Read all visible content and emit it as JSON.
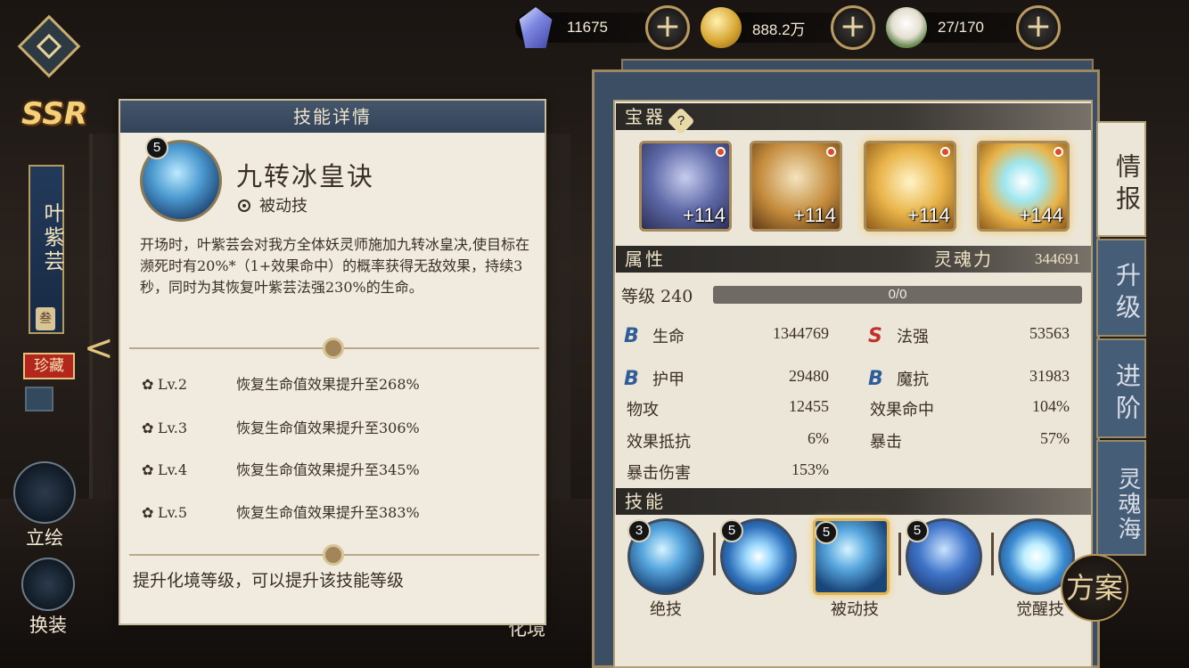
{
  "resources": [
    {
      "icon": "crystal-icon",
      "value": "11675"
    },
    {
      "icon": "gold-coin-icon",
      "value": "888.2万"
    },
    {
      "icon": "steamed-bun-icon",
      "value": "27/170"
    }
  ],
  "character": {
    "rarity": "SSR",
    "name": "叶紫芸",
    "rank_chip": "叁",
    "collect_tag": "珍藏",
    "buttons": {
      "portrait": "立绘",
      "outfit": "换装",
      "realm": "化境"
    }
  },
  "skill_detail": {
    "header": "技能详情",
    "level": "5",
    "name": "九转冰皇诀",
    "type": "被动技",
    "description": "开场时，叶紫芸会对我方全体妖灵师施加九转冰皇决,使目标在濒死时有20%*（1+效果命中）的概率获得无敌效果，持续3秒，同时为其恢复叶紫芸法强230%的生命。",
    "levels": [
      {
        "lv": "Lv.2",
        "text": "恢复生命值效果提升至268%"
      },
      {
        "lv": "Lv.3",
        "text": "恢复生命值效果提升至306%"
      },
      {
        "lv": "Lv.4",
        "text": "恢复生命值效果提升至345%"
      },
      {
        "lv": "Lv.5",
        "text": "恢复生命值效果提升至383%"
      }
    ],
    "footer": "提升化境等级，可以提升该技能等级"
  },
  "panel": {
    "treasure_title": "宝器",
    "help": "?",
    "equipment": [
      {
        "name": "robe",
        "plus": "+114"
      },
      {
        "name": "headband",
        "plus": "+114"
      },
      {
        "name": "boots",
        "plus": "+114"
      },
      {
        "name": "orb",
        "plus": "+144"
      }
    ],
    "attr_title": "属性",
    "soul_power_label": "灵魂力",
    "soul_power_value": "344691",
    "level_label": "等级 240",
    "exp": "0/0",
    "stats": {
      "hp": {
        "grade": "B",
        "label": "生命",
        "value": "1344769"
      },
      "magic": {
        "grade": "S",
        "label": "法强",
        "value": "53563"
      },
      "armor": {
        "grade": "B",
        "label": "护甲",
        "value": "29480"
      },
      "resist": {
        "grade": "B",
        "label": "魔抗",
        "value": "31983"
      },
      "phys_atk": {
        "label": "物攻",
        "value": "12455"
      },
      "hit": {
        "label": "效果命中",
        "value": "104%"
      },
      "effect_res": {
        "label": "效果抵抗",
        "value": "6%"
      },
      "crit": {
        "label": "暴击",
        "value": "57%"
      },
      "crit_dmg": {
        "label": "暴击伤害",
        "value": "153%"
      }
    },
    "skills_title": "技能",
    "skills": [
      {
        "level": "3",
        "label": "绝技"
      },
      {
        "level": "5",
        "label": ""
      },
      {
        "level": "5",
        "label": "被动技"
      },
      {
        "level": "5",
        "label": ""
      },
      {
        "level": "",
        "label": "觉醒技"
      }
    ]
  },
  "tabs": [
    "情报",
    "升级",
    "进阶",
    "灵魂海"
  ],
  "plan_button": "方案",
  "colors": {
    "accent_gold": "#c9ad6e",
    "panel_blue": "#3b4e64",
    "paper": "#ece6d8",
    "grade_b": "#2f5d9a",
    "grade_s": "#c3302a"
  }
}
